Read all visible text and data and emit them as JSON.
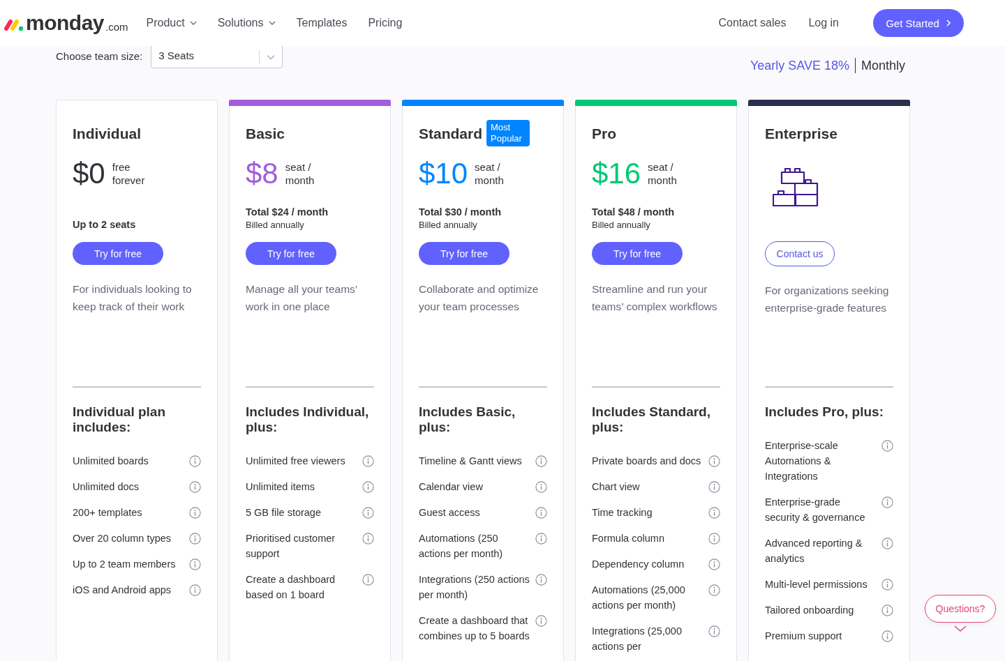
{
  "header": {
    "logo_text": "monday",
    "logo_suffix": ".com",
    "nav": [
      {
        "label": "Product",
        "dropdown": true
      },
      {
        "label": "Solutions",
        "dropdown": true
      },
      {
        "label": "Templates",
        "dropdown": false
      },
      {
        "label": "Pricing",
        "dropdown": false
      }
    ],
    "right_links": [
      "Contact sales",
      "Log in"
    ],
    "cta": "Get Started"
  },
  "team_size": {
    "label": "Choose team size:",
    "value": "3 Seats"
  },
  "billing": [
    {
      "label": "Yearly SAVE 18%",
      "selected": true
    },
    {
      "label": "Monthly",
      "selected": false
    }
  ],
  "plans": [
    {
      "kind": "free",
      "name": "Individual",
      "color": "#323338",
      "price": "$0",
      "price_note": "free forever",
      "total": "Up to 2 seats",
      "button": "Try for free",
      "description": "For individuals looking to keep track of their work",
      "includes_title": "Individual plan includes:",
      "features": [
        "Unlimited boards",
        "Unlimited docs",
        "200+ templates",
        "Over 20 column types",
        "Up to 2 team members",
        "iOS and Android apps"
      ]
    },
    {
      "kind": "paid",
      "name": "Basic",
      "color": "#a25ddc",
      "price": "$8",
      "price_note": "seat / month",
      "total": "Total $24 / month",
      "billed": "Billed annually",
      "button": "Try for free",
      "description": "Manage all your teams’ work in one place",
      "includes_title": "Includes Individual, plus:",
      "features": [
        "Unlimited free viewers",
        "Unlimited items",
        "5 GB file storage",
        "Prioritised customer support",
        "Create a dashboard based on 1 board"
      ]
    },
    {
      "kind": "paid",
      "name": "Standard",
      "badge": "Most Popular",
      "color": "#0085ff",
      "price": "$10",
      "price_note": "seat / month",
      "total": "Total $30 / month",
      "billed": "Billed annually",
      "button": "Try for free",
      "description": "Collaborate and optimize your team processes",
      "includes_title": "Includes Basic, plus:",
      "features": [
        "Timeline & Gantt views",
        "Calendar view",
        "Guest access",
        "Automations (250 actions per month)",
        "Integrations (250 actions per month)",
        "Create a dashboard that combines up to 5 boards"
      ]
    },
    {
      "kind": "paid",
      "name": "Pro",
      "color": "#00c875",
      "price": "$16",
      "price_note": "seat / month",
      "total": "Total $48 / month",
      "billed": "Billed annually",
      "button": "Try for free",
      "description": "Streamline and run your teams’ complex workflows",
      "includes_title": "Includes Standard, plus:",
      "features": [
        "Private boards and docs",
        "Chart view",
        "Time tracking",
        "Formula column",
        "Dependency column",
        "Automations (25,000 actions per month)",
        "Integrations (25,000 actions per"
      ]
    },
    {
      "kind": "enterprise",
      "name": "Enterprise",
      "color": "#292f4c",
      "button": "Contact us",
      "description": "For organizations seeking enterprise-grade features",
      "includes_title": "Includes Pro, plus:",
      "features": [
        "Enterprise-scale Automations & Integrations",
        "Enterprise-grade security & governance",
        "Advanced reporting & analytics",
        "Multi-level permissions",
        "Tailored onboarding",
        "Premium support"
      ]
    }
  ],
  "help_button": "Questions?"
}
